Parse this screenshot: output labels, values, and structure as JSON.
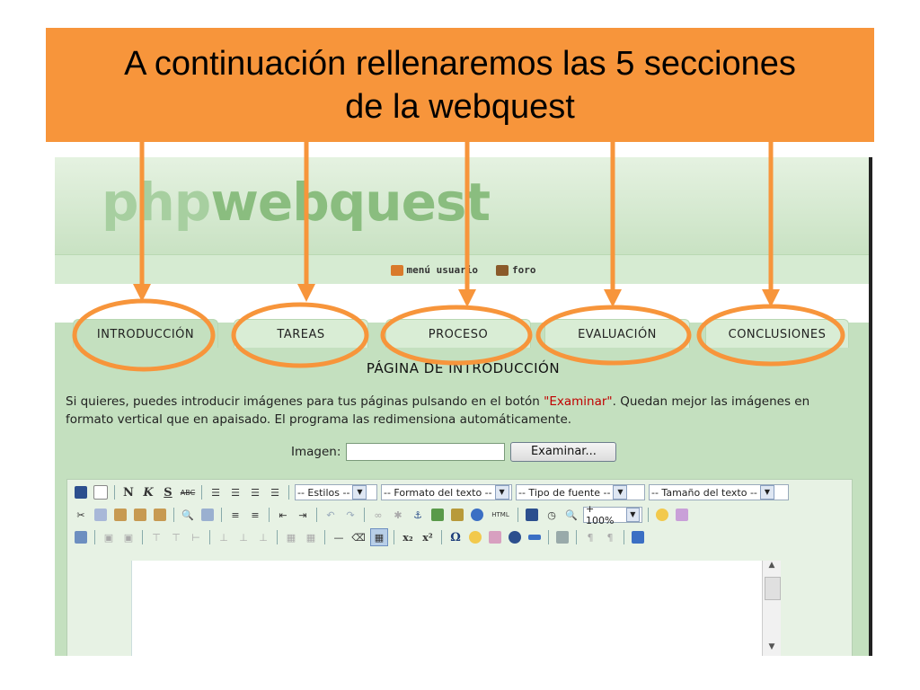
{
  "banner": {
    "line1": "A continuación rellenaremos las 5 secciones",
    "line2": "de la webquest"
  },
  "logo": {
    "part1": "php",
    "part2": "webquest"
  },
  "topnav": {
    "user_menu": "menú usuario",
    "forum": "foro"
  },
  "tabs": [
    {
      "label": "INTRODUCCIÓN"
    },
    {
      "label": "TAREAS"
    },
    {
      "label": "PROCESO"
    },
    {
      "label": "EVALUACIÓN"
    },
    {
      "label": "CONCLUSIONES"
    }
  ],
  "page_title": "PÁGINA DE INTRODUCCIÓN",
  "intro": {
    "text_before": "Si quieres, puedes introducir imágenes para tus páginas pulsando en el botón ",
    "highlight": "\"Examinar\"",
    "text_after": ". Quedan mejor las imágenes en formato vertical que en apaisado. El programa las redimensiona automáticamente."
  },
  "image_field": {
    "label": "Imagen:",
    "value": "",
    "button": "Examinar..."
  },
  "toolbar": {
    "bold": "N",
    "italic": "K",
    "strike": "S",
    "abc": "ABC",
    "styles": "-- Estilos --",
    "format": "-- Formato del texto --",
    "font": "-- Tipo de fuente --",
    "size": "-- Tamaño del texto --",
    "zoom": "+ 100%",
    "html": "HTML",
    "omega": "Ω"
  },
  "colors": {
    "banner": "#f7953b",
    "annotation": "#f7953b",
    "panel": "#c4e0bf"
  }
}
